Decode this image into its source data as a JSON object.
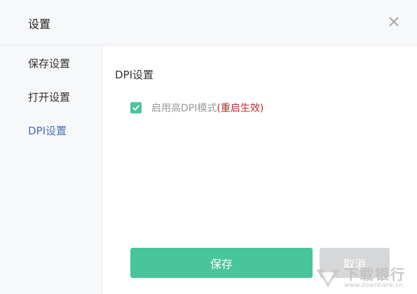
{
  "dialog": {
    "title": "设置"
  },
  "sidebar": {
    "items": [
      {
        "label": "保存设置"
      },
      {
        "label": "打开设置"
      },
      {
        "label": "DPI设置"
      }
    ]
  },
  "content": {
    "section_title": "DPI设置",
    "checkbox": {
      "label": "启用高DPI模式",
      "note": "(重启生效)",
      "checked": true
    }
  },
  "buttons": {
    "save_label": "保存",
    "cancel_label": "取消"
  },
  "watermark": {
    "brand": "下载银行",
    "url": "www.downbank.cn"
  },
  "colors": {
    "accent": "#48c59a",
    "active_nav": "#4a6db5",
    "note_red": "#c0282a"
  }
}
